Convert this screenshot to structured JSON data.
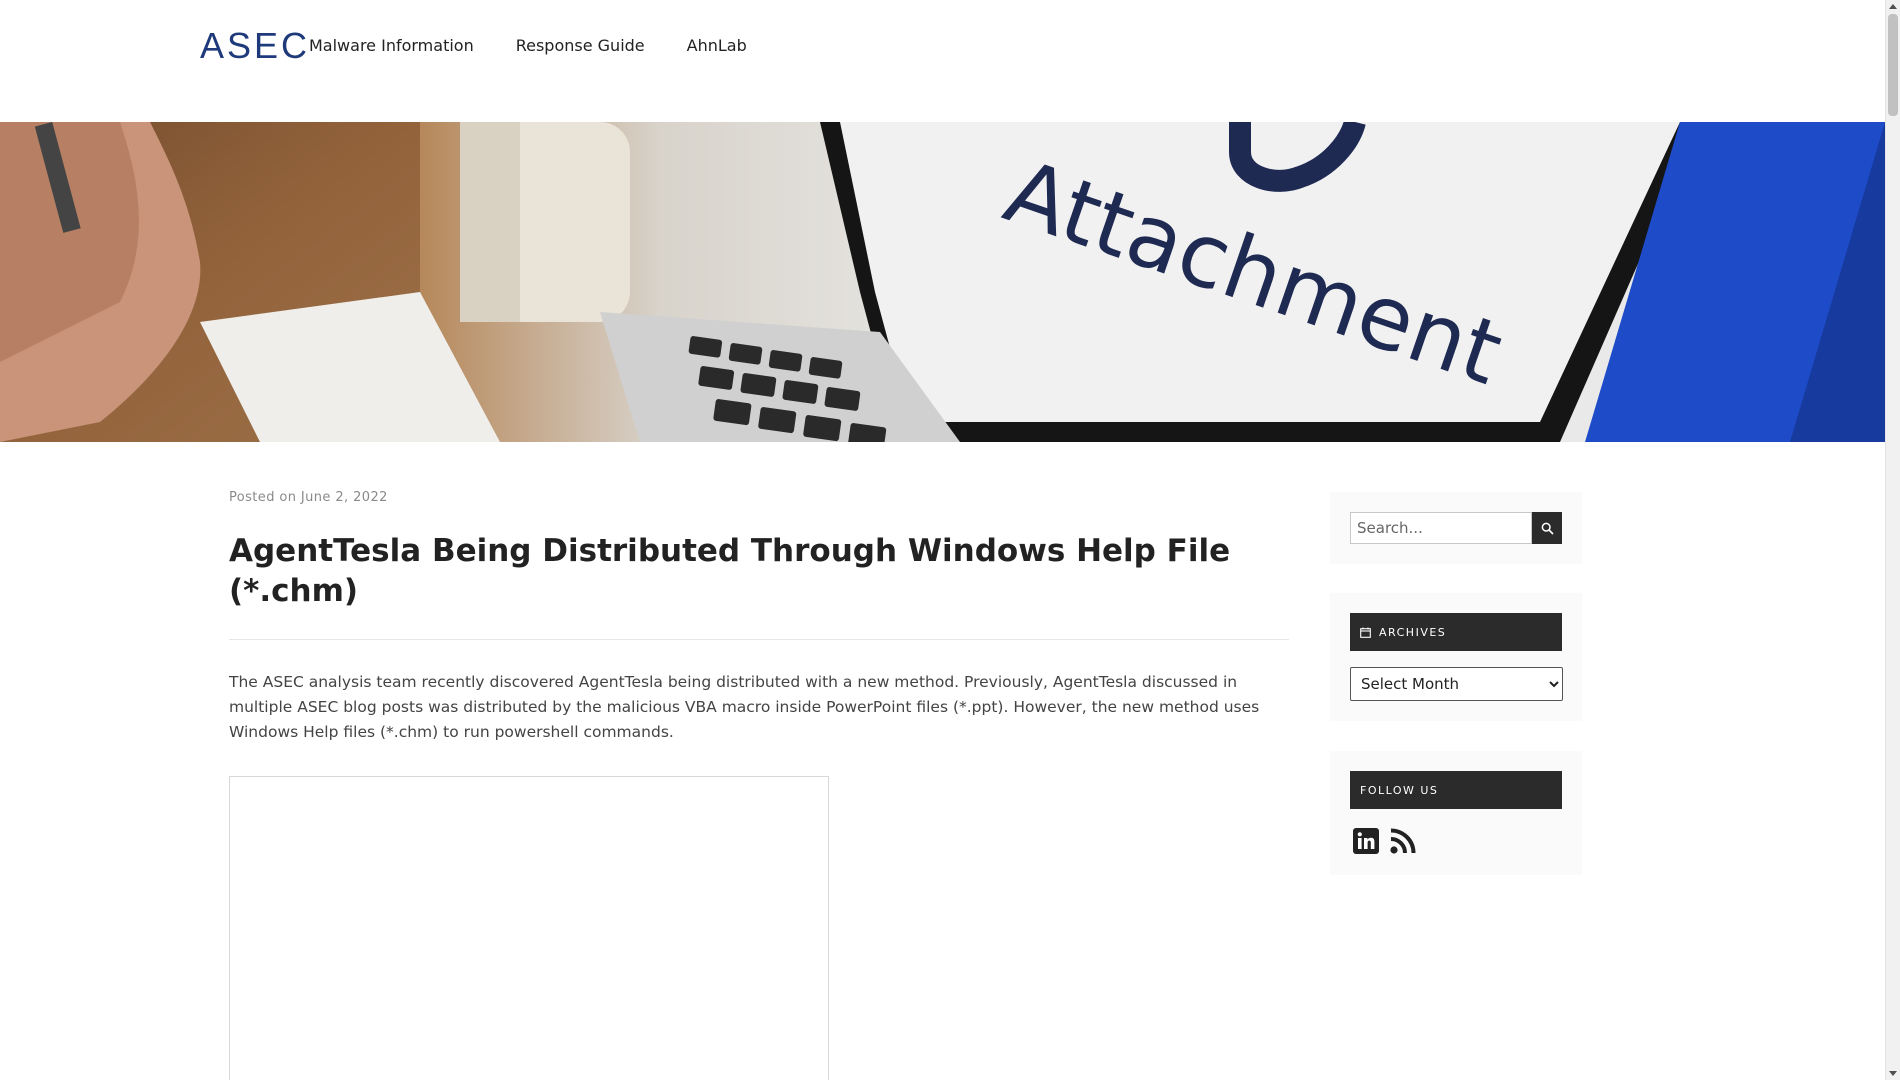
{
  "header": {
    "logo_text": "ASEC",
    "nav": [
      {
        "label": "Malware Information"
      },
      {
        "label": "Response Guide"
      },
      {
        "label": "AhnLab"
      }
    ]
  },
  "hero": {
    "image_text": "Attachment",
    "accent_color": "#1e4bc8"
  },
  "post": {
    "posted_on_label": "Posted on",
    "date": "June 2, 2022",
    "title": "AgentTesla Being Distributed Through Windows Help File (*.chm)",
    "body": "The ASEC analysis team recently discovered AgentTesla being distributed with a new method. Previously, AgentTesla discussed in multiple ASEC blog posts was distributed by the malicious VBA macro inside PowerPoint files (*.ppt). However, the new method uses Windows Help files (*.chm) to run powershell commands."
  },
  "sidebar": {
    "search": {
      "placeholder": "Search..."
    },
    "archives": {
      "title": "ARCHIVES",
      "select_value": "Select Month"
    },
    "follow": {
      "title": "FOLLOW US",
      "icons": [
        "linkedin-icon",
        "rss-icon"
      ]
    }
  },
  "colors": {
    "brand": "#1e3a7b",
    "widget_header": "#2b2b2b"
  }
}
